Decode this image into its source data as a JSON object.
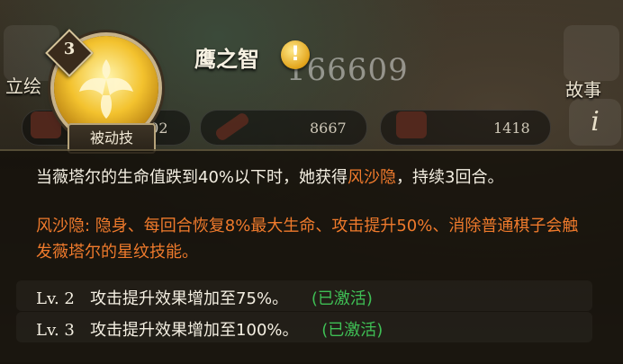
{
  "side_tabs": {
    "left": "立绘",
    "right": "故事"
  },
  "faded_score": "166609",
  "stats": [
    {
      "icon": "heart-icon",
      "value": "102"
    },
    {
      "icon": "sword-icon",
      "value": "8667"
    },
    {
      "icon": "shield-icon",
      "value": "1418"
    }
  ],
  "skill": {
    "level_badge": "3",
    "type": "被动技",
    "name": "鹰之智",
    "alert_glyph": "!",
    "description_prefix": "当薇塔尔的生命值跌到40%以下时，她获得",
    "description_highlight": "风沙隐",
    "description_suffix": "，持续3回合。",
    "effect": "风沙隐: 隐身、每回合恢复8%最大生命、攻击提升50%、消除普通棋子会触发薇塔尔的星纹技能。",
    "upgrades": [
      {
        "level": "Lv. 2",
        "text": "攻击提升效果增加至75%。",
        "status": "(已激活)"
      },
      {
        "level": "Lv. 3",
        "text": "攻击提升效果增加至100%。",
        "status": "(已激活)"
      }
    ]
  },
  "info_glyph": "i",
  "colors": {
    "highlight": "#ef7a2c",
    "activated": "#3fbf55",
    "text": "#f4efe2"
  }
}
